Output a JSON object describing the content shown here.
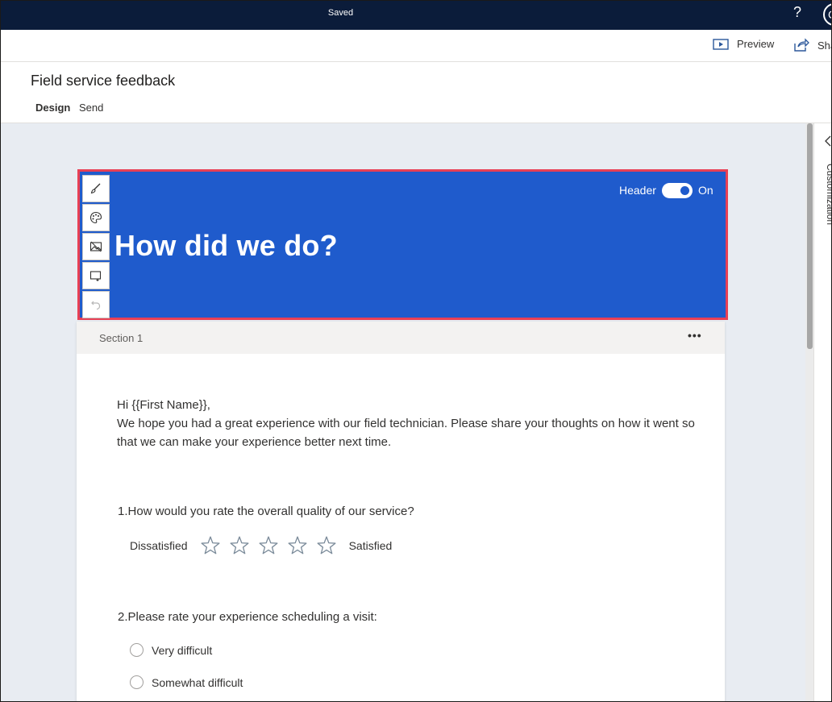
{
  "app": {
    "status": "Saved",
    "help_icon": "?",
    "avatar_initial": "C"
  },
  "commands": {
    "preview_label": "Preview",
    "share_label": "Sha"
  },
  "survey": {
    "title": "Field service feedback",
    "tabs": [
      {
        "label": "Design",
        "active": true
      },
      {
        "label": "Send",
        "active": false
      }
    ]
  },
  "header": {
    "heading": "How did we do?",
    "toggle_label": "Header",
    "toggle_state": "On",
    "background_color": "#1f5bcc",
    "highlight_color": "#e84055",
    "tools": [
      {
        "name": "brush-icon"
      },
      {
        "name": "palette-icon"
      },
      {
        "name": "image-icon"
      },
      {
        "name": "resize-icon"
      },
      {
        "name": "undo-icon"
      }
    ]
  },
  "side_panel": {
    "label": "Customization"
  },
  "section": {
    "label": "Section 1",
    "more": "•••",
    "intro_line1": "Hi {{First Name}},",
    "intro_line2": "We hope you had a great experience with our field technician. Please share your thoughts on how it went so that we can make your experience better next time.",
    "q1": {
      "number": "1.",
      "text": "How would you rate the overall quality of our service?",
      "low_label": "Dissatisfied",
      "high_label": "Satisfied",
      "star_count": 5
    },
    "q2": {
      "number": "2.",
      "text": "Please rate your experience scheduling a visit:",
      "options": [
        "Very difficult",
        "Somewhat difficult"
      ]
    }
  }
}
